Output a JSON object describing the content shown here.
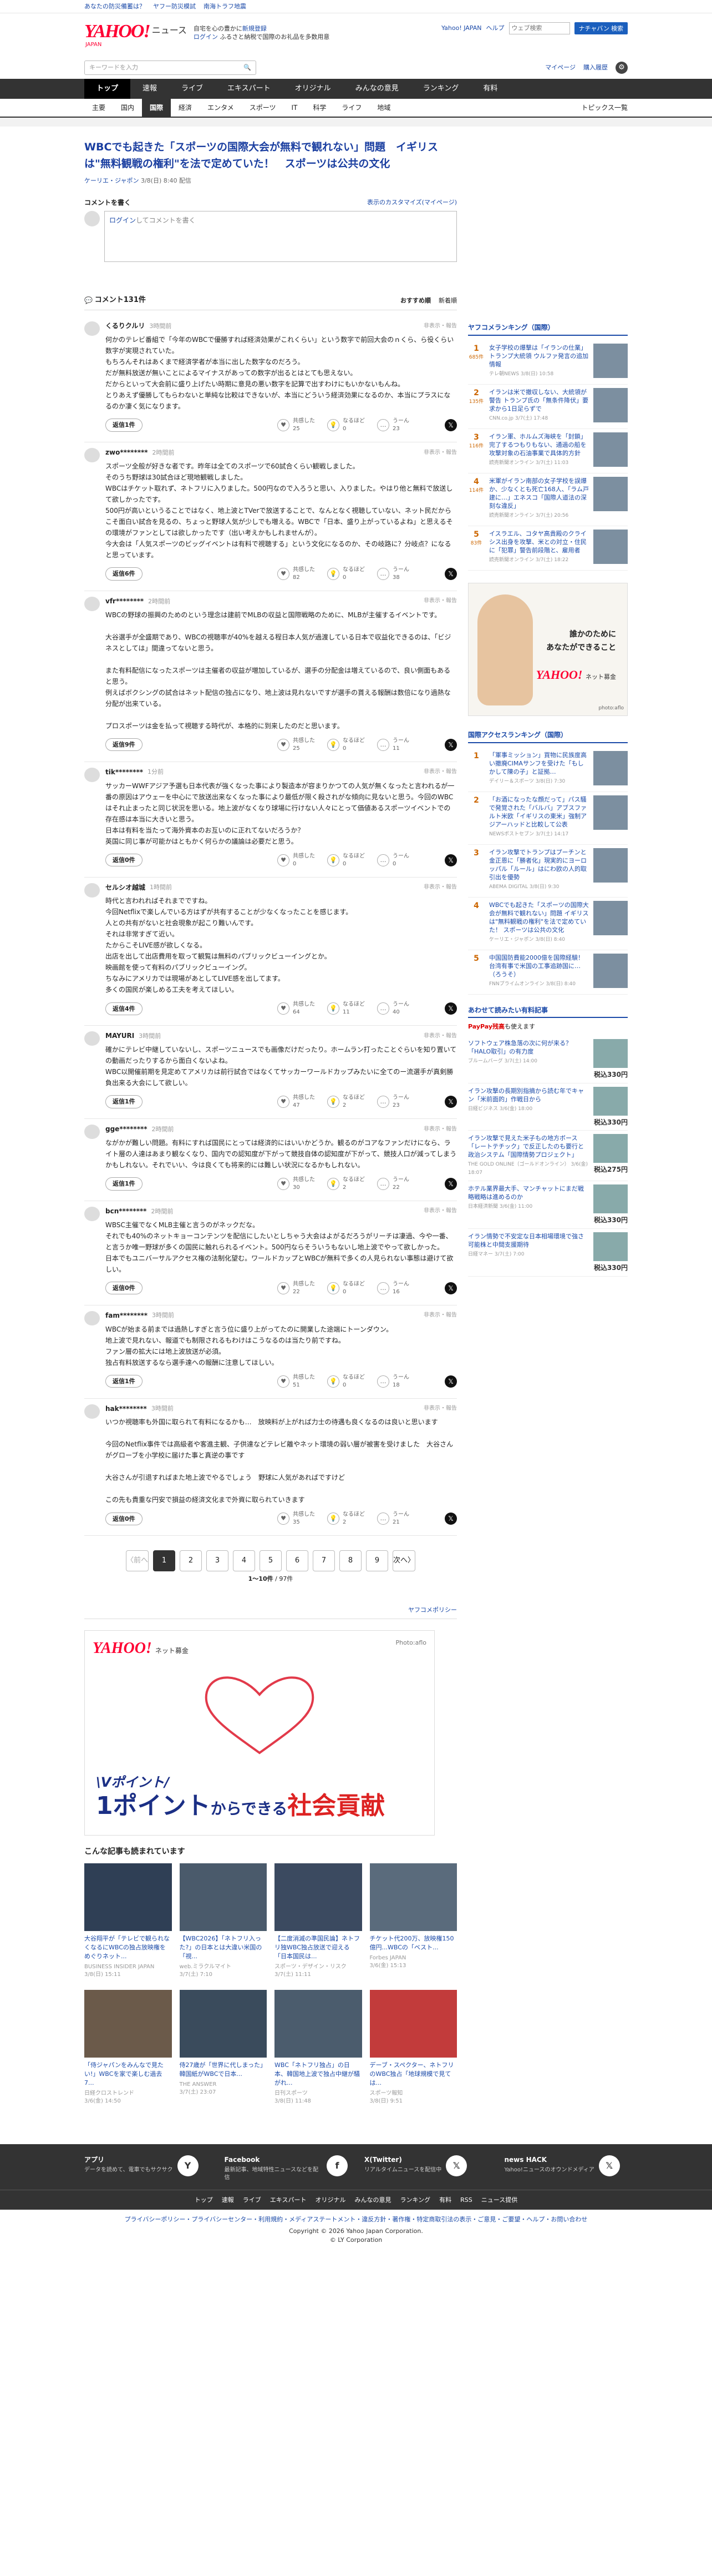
{
  "topbar": {
    "links": [
      "あなたの防災備蓄は？",
      "ヤフー防災模試",
      "南海トラフ地震"
    ]
  },
  "masthead": {
    "logo": "YAHOO!",
    "logo_sub": "JAPAN",
    "section": "ニュース",
    "promo1_a": "自宅を心の豊かに",
    "promo1_b": "新規登録",
    "promo2_a": "ログイン",
    "promo2_b": "ふるさと納税で国際のお礼品を多数用意",
    "right_links": [
      "Yahoo! JAPAN",
      "ヘルプ"
    ],
    "search_placeholder": "ウェブ検索",
    "search_button": "ナチャバン 検索"
  },
  "searchrow": {
    "placeholder": "キーワードを入力",
    "links": [
      "マイページ",
      "購入履歴"
    ]
  },
  "mainnav": [
    "トップ",
    "速報",
    "ライブ",
    "エキスパート",
    "オリジナル",
    "みんなの意見",
    "ランキング",
    "有料"
  ],
  "subnav": {
    "items": [
      "主要",
      "国内",
      "国際",
      "経済",
      "エンタメ",
      "スポーツ",
      "IT",
      "科学",
      "ライフ",
      "地域"
    ],
    "more": "トピックス一覧"
  },
  "article": {
    "title": "WBCでも起きた「スポーツの国際大会が無料で観れない」問題　イギリスは\"無料観戦の権利\"を法で定めていた！　スポーツは公共の文化",
    "source": "ケーリエ・ジャポン",
    "date": "3/8(日) 8:40",
    "date_suffix": "配信"
  },
  "comments_header": {
    "label": "コメントを書く",
    "settings": "表示のカスタマイズ(マイページ)",
    "input_login": "ログイン",
    "input_text": "してコメントを書く",
    "count": "コメント131件",
    "sort": [
      "おすすめ順",
      "新着順"
    ]
  },
  "comments": [
    {
      "name": "くるりクルリ",
      "time": "3時間前",
      "report": "非表示・報告",
      "text": "何かのテレビ番組で「今年のWBCで優勝すれば経済効果がこれくらい」という数字で前回大会のｎくら、ら役くらい数字が実現されていた。\nもちろんそれはあくまで経済学者が本当に出した数字なのだろう。\nだが無料放送が無いことによるマイナスがあっての数字が出るとはとても思えない。\nだからといって大会前に盛り上げたい時期に意見の悪い数字を記算で出すわけにもいかないもんね。\nとりあえず優勝してもらわないと単純な比較はできないが、本当にどういう経済効果になるのか、本当にプラスになるのか凄く気になります。",
      "reply": "返信1件",
      "v1": "25",
      "v2": "0",
      "v3": "23"
    },
    {
      "name": "zwo********",
      "time": "2時間前",
      "report": "非表示・報告",
      "text": "スポーツ全般が好きな者です。昨年は全てのスポーツで60試合くらい観戦しました。\nそのうち野球は30試合ほど現地観戦しました。\nWBCはチケット取れず、ネトフリに入りました。500円なので入ろうと思い、入りました。やはり他と無料で放送して欲しかったです。\n500円が高いというることではなく、地上波とTVerで放送することで、なんとなく視聴していない、ネット民だからこそ面白い試合を見るの、ちょっと野球人気が少しでも増える。WBCで「日本、盛り上がっているよね」と思えるその環境がファンとしては欲しかったです（出い考えかもしれませんが）。\n今大会は「人気スポーツのビッグイベントは有料で視聴する」という文化になるのか、その岐路に？分岐点？になると思っています。",
      "reply": "返信6件",
      "v1": "82",
      "v2": "0",
      "v3": "38"
    },
    {
      "name": "vfr********",
      "time": "2時間前",
      "report": "非表示・報告",
      "text": "WBCの野球の振興のためのという理念は建前でMLBの収益と国際戦略のために、MLBが主催するイベントです。\n\n大谷選手が全盛期であり、WBCの視聴率が40%を越える程日本人気が過渡している日本で収益化できるのは、「ビジネスとしては」間違ってないと思う。\n\nまた有料配信になったスポーツは主催者の収益が増加しているが、選手の分配金は増えているので、良い側面もあると思う。\n例えばボクシングの試合はネット配信の独占になり、地上波は見れないですが選手の貰える報酬は数倍になり過熱な分配が出来ている。\n\nプロスポーツは金を払って視聴する時代が、本格的に到来したのだと思います。",
      "reply": "返信9件",
      "v1": "25",
      "v2": "0",
      "v3": "11"
    },
    {
      "name": "tik********",
      "time": "1分前",
      "report": "非表示・報告",
      "text": "サッカーWWFアジア予選も日本代表が強くなった事により製造本が容まりかつての人気が無くなったと言われるが一番の原因はアウェーを中心にで放送出来なくなった事により最低が限く殺されがな傾向に見ないと思う。今回のWBCはそれ止まったと同じ状況を思いる。地上波がなくなり球場に行けない人々にとって価値あるスポーツイベントでの存在感は本当に大きいと思う。\n日本は有料を当たって海外資本のお互いのに正れてないだろうか？\n英国に同じ事が可能かはともかく何らかの議論は必要だと思う。",
      "reply": "返信0件",
      "v1": "0",
      "v2": "0",
      "v3": "0"
    },
    {
      "name": "セルシオ越城",
      "time": "1時間前",
      "report": "非表示・報告",
      "text": "時代と言われればそれまでですね。\n今回Netflixで楽しんでいる方はずが共有することが少なくなったことを感じます。\n人との共有がないと社会現象が起こり難いんです。\nそれは非常すぎて近い。\nたからこそLIVE感が欲しくなる。\n出店を出して出店費用を取って観覧は無料のパブリックビューイングとか。\n映画館を使って有料のパブリックビューイング。\nちなみにアメリカでは現場があとしてLIVE感を出してます。\n多くの国民が楽しめる工夫を考えてほしい。",
      "reply": "返信4件",
      "v1": "64",
      "v2": "11",
      "v3": "40"
    },
    {
      "name": "MAYURI",
      "time": "3時間前",
      "report": "非表示・報告",
      "text": "確かにテレビ中継していないし、スポーツニュースでも画像だけだったり。ホームラン打ったことぐらいを知り置いての動画だったりするから面白くないよね。\nWBC以開催前期を見定めてアメリカは前行試合ではなくてサッカーワールドカップみたいに全てのー流選手が真剣勝負出来る大会にして欲しい。",
      "reply": "返信1件",
      "v1": "47",
      "v2": "2",
      "v3": "23"
    },
    {
      "name": "gge********",
      "time": "2時間前",
      "report": "非表示・報告",
      "text": "ながかが難しい問題。有料にすれば国民にとっては経済的にはいいかどうか。観るのがコアなファンだけになら、ライト層の人達はあまり観なくなり、国内での認知度が下がって競技自体の認知度が下がって、競技人口が減ってしまうかもしれない。それでいい、今は良くても将来的には難しい状況になるかもしれない。",
      "reply": "返信1件",
      "v1": "30",
      "v2": "2",
      "v3": "22"
    },
    {
      "name": "bcn********",
      "time": "2時間前",
      "report": "非表示・報告",
      "text": "WBSC主催でなくMLB主催と言うのがネックだな。\nそれでも40%のネットキョーコンテンツを配信にしたいとしちゃう大会はよがるだろうがリーチは凄過、今や一番、と言うか唯一野球が多くの国民に触れられるイベント。500円ならそういうもないし地上波でやって欲しかった。\n日本でもユニバーサルアクセス権の法制化望む。ワールドカップとWBCが無料で多くの人見られない事態は避けて欲しい。",
      "reply": "返信0件",
      "v1": "22",
      "v2": "0",
      "v3": "16"
    },
    {
      "name": "fam********",
      "time": "3時間前",
      "report": "非表示・報告",
      "text": "WBCが始まる前までは過熱しすぎと言う位に盛り上がってたのに開業した途端にトーンダウン。\n地上波で見れない、報道でも制限されるもわけはこうなるのは当たり前ですね。\nファン層の拡大には地上波放送が必須。\n独占有料放送するなら選手達への報酬に注意してほしい。",
      "reply": "返信1件",
      "v1": "51",
      "v2": "0",
      "v3": "18"
    },
    {
      "name": "hak********",
      "time": "3時間前",
      "report": "非表示・報告",
      "text": "いつか視聴率も外国に取られて有料になるかも…　放映料が上がれば力士の待遇も良くなるのは良いと思います\n\n今回のNetflix事件では高級者や客進主観、子供達などテレビ離やネット環境の弱い層が被害を受けました　大谷さんがグローブを小学校に届けた事と真逆の事です\n\n大谷さんが引退すればまた地上波でやるでしょう　野球に人気があればですけど\n\nこの先も貴重な円安で損益の経済文化まで外資に取られていきます",
      "reply": "返信0件",
      "v1": "35",
      "v2": "2",
      "v3": "21"
    }
  ],
  "labels": {
    "vote1": "共感した",
    "vote2": "なるほど",
    "vote3": "うーん",
    "x": "𝕏"
  },
  "pager": {
    "prev": "〈前へ",
    "pages": [
      "1",
      "2",
      "3",
      "4",
      "5",
      "6",
      "7",
      "8",
      "9"
    ],
    "next": "次へ〉",
    "count": "1〜10件",
    "total": "/ 97件"
  },
  "policy": "ヤフコメポリシー",
  "banner": {
    "logo": "YAHOO!",
    "logo_sub": "ネット募金",
    "photo": "Photo:aflo",
    "line1": "\\Vポイント/",
    "line2a": "1ポイント",
    "line2b": "からできる",
    "line2c": "社会貢献"
  },
  "also_read": {
    "heading": "こんな記事も読まれています",
    "items": [
      {
        "title": "大谷翔平が「テレビで観られなくなるにWBCの独占放映権をめぐりネット...",
        "src": "BUSINESS INSIDER JAPAN",
        "date": "3/8(日) 15:11"
      },
      {
        "title": "【WBC2026】「ネトフリ入った?」の日本とは大違い米国の「視...",
        "src": "web.ミラクルマイト",
        "date": "3/7(土) 7:10"
      },
      {
        "title": "【二度消滅の準国民論】ネトフリ独WBC独占放送で迎える「日本国民は...",
        "src": "スポーツ・デザイン・リスク",
        "date": "3/7(土) 11:11"
      },
      {
        "title": "チケット代200万、放映権150億円...WBCの「ベスト...",
        "src": "Forbes JAPAN",
        "date": "3/6(金) 15:13"
      },
      {
        "title": "「侍ジャパンをみんなで見たい!」WBCを家で楽しむ過去7...",
        "src": "日経クロストレンド",
        "date": "3/6(金) 14:50"
      },
      {
        "title": "侍27歳が「世界に代しまった」韓国紙がWBCで日本...",
        "src": "THE ANSWER",
        "date": "3/7(土) 23:07"
      },
      {
        "title": "WBC「ネトフリ独占」の日本、韓国地上波で独占中継が騒がれ...",
        "src": "日刊スポーツ",
        "date": "3/8(日) 11:48"
      },
      {
        "title": "デーブ・スペクター、ネトフリのWBC独占「地球規模で見ては...",
        "src": "スポーツ報知",
        "date": "3/8(日) 9:51"
      }
    ]
  },
  "sidebar": {
    "ranking_title": "ヤフコメランキング（国際）",
    "ranking": [
      {
        "no": "1",
        "cnt": "685件",
        "title": "女子学校の爆撃は「イランの仕業」トランプ大統領 ウルファ発言の追加情報",
        "src": "テレ朝NEWS",
        "date": "3/8(日) 10:58"
      },
      {
        "no": "2",
        "cnt": "135件",
        "title": "イランは米で撤収しない、大統領が警告 トランプ氏の「無条件降伏」要求から1日足らずで",
        "src": "CNN.co.jp",
        "date": "3/7(土) 17:48"
      },
      {
        "no": "3",
        "cnt": "116件",
        "title": "イラン軍、ホルムズ海峡を「封鎖」完了するつもりもない、通過の船を攻撃対象の石油事業で具体的方針",
        "src": "読売新聞オンライン",
        "date": "3/7(土) 11:03"
      },
      {
        "no": "4",
        "cnt": "114件",
        "title": "米軍がイラン南部の女子学校を誤爆か、少なくとも死亡168人、「ラム戸建に…」エネスコ「国際人道法の深刻な違反」",
        "src": "読売新聞オンライン",
        "date": "3/7(土) 20:56"
      },
      {
        "no": "5",
        "cnt": "83件",
        "title": "イスラエル、コタヤ高貴殿のクライシス出身を攻撃、米との対立・住民に「犯罪」警告前段階と、雇用者",
        "src": "読売新聞オンライン",
        "date": "3/7(土) 18:22"
      }
    ],
    "ad_text1": "誰かのために",
    "ad_text2": "あなたができること",
    "ad_logo": "YAHOO!",
    "ad_logo_sub": "ネット募金",
    "ad_photo": "photo:aflo",
    "access_title": "国際アクセスランキング（国際）",
    "access": [
      {
        "no": "1",
        "title": "「軍事ミッション」買物に民族度高い撤廃CIMAサンフを受けた「もしかして陳の子」と証拠…",
        "src": "デイリー＆スポーツ",
        "date": "3/8(日) 7:30"
      },
      {
        "no": "2",
        "title": "「お酒になったな顔だって」パス騒で発覚された「バルバ」アブスファルト米欧「イギリスの東米」強制アジアーハッドと比較して公表",
        "src": "NEWSポストセブン",
        "date": "3/7(土) 14:17"
      },
      {
        "no": "3",
        "title": "イラン攻撃でトランプはプーチンと金正恩に「勝者化」現実的にヨーロッパル「ルール」はにわ欧の人的取引出を優勢",
        "src": "ABEMA DIGITAL",
        "date": "3/8(日) 9:30"
      },
      {
        "no": "4",
        "title": "WBCでも起きた「スポーツの国際大会が無料で観れない」問題 イギリスは\"無料観戦の権利\"を法で定めていた！ スポーツは公共の文化",
        "src": "ケーリエ・ジャポン",
        "date": "3/8(日) 8:40"
      },
      {
        "no": "5",
        "title": "中国国防費能2000億を国際経験！ 台湾有事で米国の工事追跡国に…（ろうそ）",
        "src": "FNNプライムオンライン",
        "date": "3/8(日) 8:40"
      }
    ],
    "recommend_title": "あわせて読みたい有料記事",
    "paypay": "PayPay残高",
    "paypay_tail": "も使えます",
    "recommend": [
      {
        "title": "ソフトウェア株急落の次に何が来る？「HALO取引」の有力度",
        "src": "ブルームバーグ",
        "date": "3/7(土) 14:00",
        "price": "税込330円"
      },
      {
        "title": "イラン攻撃の長期別指摘から読む年でキャン「米前面的」作戦日から",
        "src": "日経ビジネス",
        "date": "3/6(金) 18:00",
        "price": "税込330円"
      },
      {
        "title": "イラン攻撃で見えた米子もの地方ボース「レートテチック」で反正したのも要行と政治システム「国際情勢プロジェクト」",
        "src": "THE GOLD ONLINE（ゴールドオンライン）",
        "date": "3/6(金) 18:07",
        "price": "税込275円"
      },
      {
        "title": "ホテル業界最大手、マンチャットにまだ戦略戦略は進めるのか",
        "src": "日本経済新聞",
        "date": "3/6(金) 11:00",
        "price": "税込330円"
      },
      {
        "title": "イラン情勢で不安定な日本相場環境で強さ可能株と中間支援期待",
        "src": "日経マネー",
        "date": "3/7(土) 7:00",
        "price": "税込330円"
      }
    ]
  },
  "footer": {
    "apps": [
      {
        "title": "アプリ",
        "desc": "データを読めて、電車でもサクサク",
        "icon": "Y"
      },
      {
        "title": "Facebook",
        "desc": "最新記事、地域特性ニュースなどを配信",
        "icon": "f"
      },
      {
        "title": "X(Twitter)",
        "desc": "リアルタイムニュースを配信中",
        "icon": "𝕏"
      },
      {
        "title": "news HACK",
        "desc": "Yahoo!ニュースのオウンドメディア",
        "icon": "𝕏"
      }
    ],
    "nav": [
      "トップ",
      "速報",
      "ライブ",
      "エキスパート",
      "オリジナル",
      "みんなの意見",
      "ランキング",
      "有料",
      "RSS",
      "ニュース提供"
    ],
    "bottom": "プライバシーポリシー・プライバシーセンター・利用規約・メディアステートメント・違反方針・著作権・特定商取引法の表示・ご意見・ご要望・ヘルプ・お問い合わせ",
    "copy1": "Copyright © 2026 Yahoo Japan Corporation.",
    "copy2": "© LY Corporation"
  }
}
